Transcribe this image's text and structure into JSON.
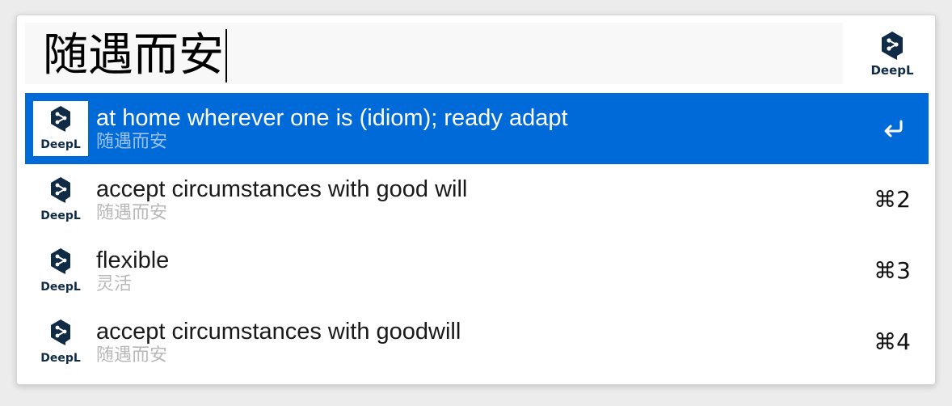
{
  "search": {
    "query": "随遇而安"
  },
  "brand": {
    "logo_text": "DeepL",
    "accent": "#0f2b46",
    "selection": "#006ad8"
  },
  "results": [
    {
      "title": "at home wherever one is (idiom); ready adapt",
      "subtitle": "随遇而安",
      "shortcut": "",
      "shortcut_icon": "return-icon",
      "selected": true
    },
    {
      "title": "accept circumstances with good will",
      "subtitle": "随遇而安",
      "shortcut": "⌘2",
      "selected": false
    },
    {
      "title": "flexible",
      "subtitle": "灵活",
      "shortcut": "⌘3",
      "selected": false
    },
    {
      "title": "accept circumstances with goodwill",
      "subtitle": "随遇而安",
      "shortcut": "⌘4",
      "selected": false
    }
  ]
}
